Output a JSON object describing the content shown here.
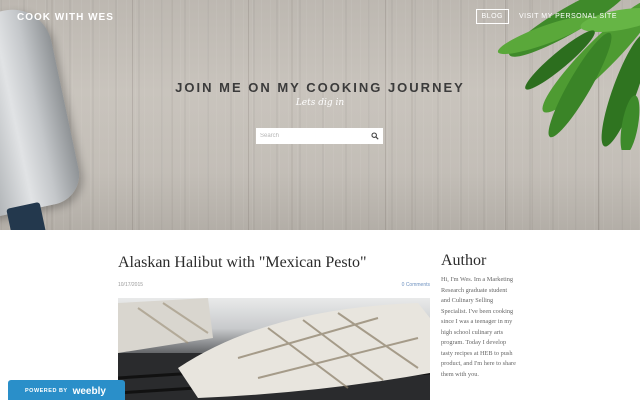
{
  "header": {
    "site_title": "COOK WITH WES",
    "nav": [
      {
        "label": "BLOG",
        "active": true
      },
      {
        "label": "VISIT MY PERSONAL SITE",
        "active": false
      }
    ]
  },
  "hero": {
    "headline": "JOIN ME ON MY COOKING JOURNEY",
    "subheadline": "Lets dig in",
    "search": {
      "placeholder": "Search",
      "icon": "search-icon"
    }
  },
  "post": {
    "title": "Alaskan Halibut with \"Mexican Pesto\"",
    "date": "10/17/2015",
    "comments": "0 Comments"
  },
  "sidebar": {
    "heading": "Author",
    "bio": "Hi, I'm Wes. Im a Marketing Research graduate student and Culinary Selling Specialist. I've been cooking since I was a teenager in my high school culinary arts program. Today I develop tasty recipes at HEB to push product, and I'm here to share them with you."
  },
  "badge": {
    "powered": "POWERED BY",
    "brand": "weebly"
  },
  "colors": {
    "accent_link": "#6f92c0",
    "badge_blue": "#2a8fc9",
    "hero_headline": "#3b3b3b"
  }
}
